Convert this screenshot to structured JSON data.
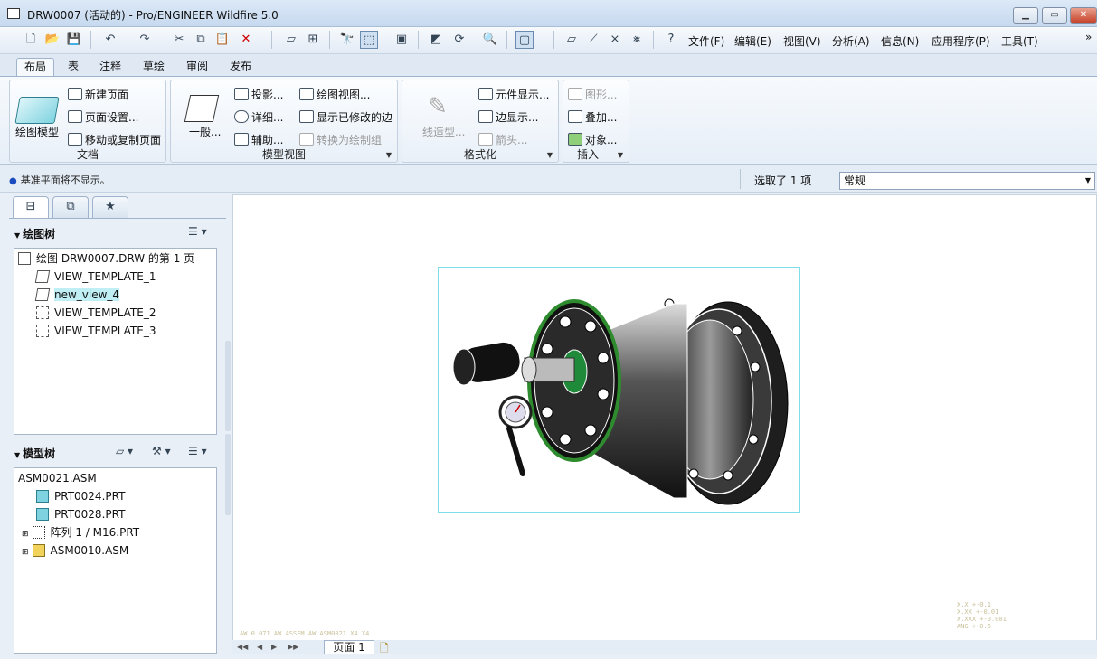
{
  "window": {
    "title": "DRW0007 (活动的) - Pro/ENGINEER Wildfire 5.0"
  },
  "menus": [
    "文件(F)",
    "编辑(E)",
    "视图(V)",
    "分析(A)",
    "信息(N)",
    "应用程序(P)",
    "工具(T)"
  ],
  "menu_overflow": "»",
  "ribbon_tabs": [
    "布局",
    "表",
    "注释",
    "草绘",
    "审阅",
    "发布"
  ],
  "groups": {
    "document": {
      "label": "文档",
      "big": "绘图模型",
      "items": [
        "新建页面",
        "页面设置...",
        "移动或复制页面"
      ]
    },
    "model_view": {
      "label": "模型视图",
      "big": "一般...",
      "col1": [
        "投影...",
        "详细...",
        "辅助..."
      ],
      "col2": [
        "绘图视图...",
        "显示已修改的边",
        "转换为绘制组"
      ]
    },
    "format": {
      "label": "格式化",
      "big": "线造型...",
      "items": [
        "元件显示...",
        "边显示...",
        "箭头..."
      ]
    },
    "insert": {
      "label": "插入",
      "items": [
        "图形...",
        "叠加...",
        "对象..."
      ]
    }
  },
  "message": "基准平面将不显示。",
  "selection_status": "选取了 1 项",
  "filter": {
    "value": "常规"
  },
  "drawing_tree": {
    "title": "绘图树",
    "items": [
      "绘图 DRW0007.DRW 的第 1 页",
      "VIEW_TEMPLATE_1",
      "new_view_4",
      "VIEW_TEMPLATE_2",
      "VIEW_TEMPLATE_3"
    ]
  },
  "model_tree": {
    "title": "模型树",
    "items": [
      "ASM0021.ASM",
      "PRT0024.PRT",
      "PRT0028.PRT",
      "阵列 1 / M16.PRT",
      "ASM0010.ASM"
    ]
  },
  "page_tab": "页面 1",
  "canvas_footer": "AW 0.071   AW ASSEM   AW ASM0021   X4 X4",
  "tolerance_notes": [
    "X.X   +-0.1",
    "X.XX  +-0.01",
    "X.XXX +-0.001",
    "ANG   +-0.5"
  ],
  "colors": {
    "accent": "#1a4cc0",
    "view_border": "#7fdde6",
    "selected_bg": "#bfeef5"
  }
}
